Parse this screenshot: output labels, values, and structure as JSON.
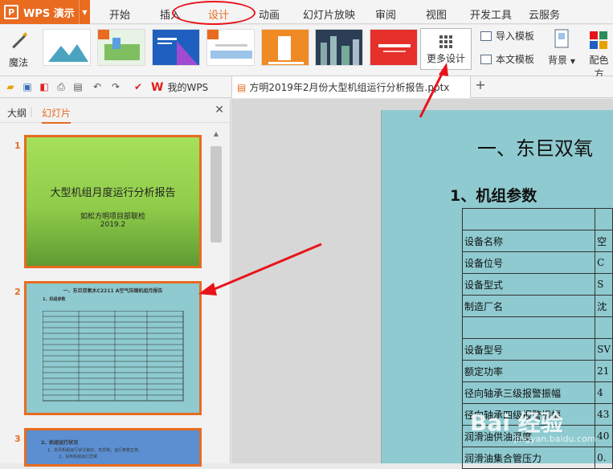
{
  "app": {
    "name": "WPS 演示",
    "logo_letter": "P"
  },
  "menu": [
    "开始",
    "插入",
    "设计",
    "动画",
    "幻灯片放映",
    "审阅",
    "视图",
    "开发工具",
    "云服务"
  ],
  "menu_active_index": 2,
  "ribbon": {
    "magic_label": "魔法",
    "more_design_label": "更多设计",
    "import_template_label": "导入模板",
    "text_template_label": "本文模板",
    "background_label": "背景",
    "color_scheme_label": "配色方"
  },
  "tabs": {
    "wps_home": "我的WPS",
    "document": "方明2019年2月份大型机组运行分析报告.pptx"
  },
  "panel": {
    "tab_outline": "大纲",
    "tab_slides": "幻灯片"
  },
  "slides": [
    {
      "number": "1",
      "title": "大型机组月度运行分析报告",
      "subtitle": "如松方明项目部联检",
      "date": "2019.2"
    },
    {
      "number": "2",
      "title": "一、东巨双氧水C2211 A空气压缩机组月报告",
      "section": "1、机组参数"
    },
    {
      "number": "3",
      "title": "2、机组运行状况",
      "line1": "1、本月机组运行状况良好，无异常，运行参数正常。",
      "line2": "2、没有机组运行异常"
    }
  ],
  "main_slide": {
    "title": "一、东巨双氧",
    "section": "1、机组参数",
    "rows": [
      [
        "",
        ""
      ],
      [
        "设备名称",
        "空"
      ],
      [
        "设备位号",
        "C"
      ],
      [
        "设备型式",
        "S"
      ],
      [
        "制造厂名",
        "沈"
      ],
      [
        "",
        ""
      ],
      [
        "设备型号",
        "SV"
      ],
      [
        "额定功率",
        "21"
      ],
      [
        "径向轴承三级报警振幅",
        "4"
      ],
      [
        "径向轴承四级报警振幅",
        "43"
      ],
      [
        "润滑油供油温度",
        "40"
      ],
      [
        "润滑油集合管压力",
        "0."
      ]
    ]
  },
  "watermark": {
    "main": "Bai 经验",
    "sub": "jingyan.baidu.com"
  },
  "colors": {
    "accent": "#e86b1f",
    "highlight_ring": "#e8141a",
    "slide_bg": "#8ecad0"
  }
}
